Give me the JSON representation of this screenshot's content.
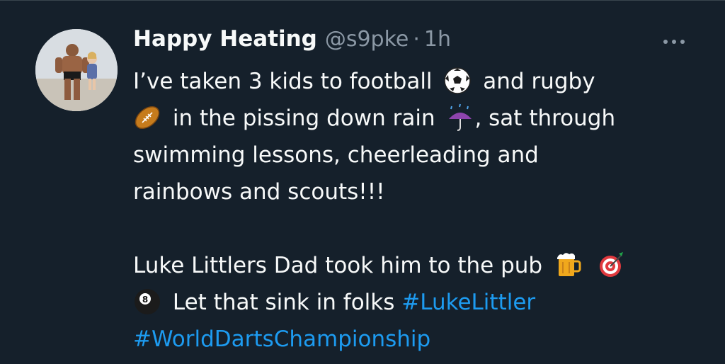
{
  "author": {
    "display_name": "Happy Heating",
    "handle": "@s9pke",
    "separator": "·",
    "time": "1h"
  },
  "body": {
    "line1_a": "I’ve taken 3 kids to football",
    "line1_b": "and rugby",
    "line2_a": "in the pissing down rain",
    "line2_b": ", sat through",
    "line3": "swimming lessons, cheerleading and",
    "line4": "rainbows and scouts!!!",
    "line5": "Luke Littlers Dad took him to the pub",
    "line6": "Let that sink in folks",
    "hashtag1": "#LukeLittler",
    "hashtag2": "#WorldDartsChampionship"
  },
  "emojis": [
    "soccer-ball",
    "rugby-ball",
    "umbrella-rain",
    "beer-mug",
    "dart-target",
    "8-ball"
  ],
  "colors": {
    "background": "#15202b",
    "text": "#f7f9f9",
    "secondary": "#8b98a5",
    "link": "#1d9bf0"
  }
}
